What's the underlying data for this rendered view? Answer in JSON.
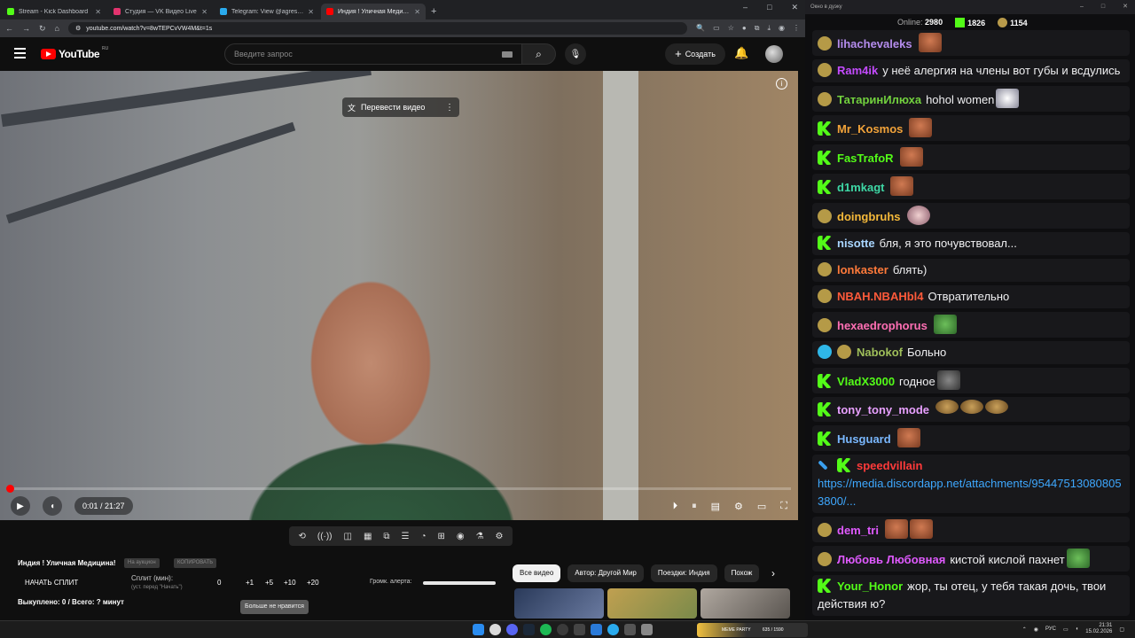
{
  "browser": {
    "tabs": [
      {
        "title": "Stream - Kick Dashboard",
        "color": "#53fc18",
        "active": false
      },
      {
        "title": "Студия — VK Видео Live",
        "color": "#e3336e",
        "active": false
      },
      {
        "title": "Telegram: View @agressorR23",
        "color": "#2aabee",
        "active": false
      },
      {
        "title": "Индия ! Уличная Медицина!",
        "color": "#ff0000",
        "active": true
      }
    ],
    "url": "youtube.com/watch?v=8wTEPCvVW4M&t=1s"
  },
  "youtube": {
    "logo_text": "YouTube",
    "logo_region": "RU",
    "search_placeholder": "Введите запрос",
    "create_label": "Создать"
  },
  "video": {
    "translate_label": "Перевести видео",
    "time": "0:01 / 21:27",
    "progress": 0.0008
  },
  "extension": {
    "title": "Индия ! Уличная Медицина!",
    "auction_btn": "На аукцион",
    "copy_btn": "КОПИРОВАТЬ",
    "start_split": "НАЧАТЬ СПЛИТ",
    "split_label": "Сплит (мин):",
    "split_hint": "(уст. перед \"Начать\")",
    "split_value": "0",
    "increments": [
      "+1",
      "+5",
      "+10",
      "+20"
    ],
    "alert_label": "Громк. алерта:",
    "bought": "Выкуплено: 0 / Всего: ? минут",
    "tooltip": "Больше не нравится"
  },
  "chips": [
    "Все видео",
    "Автор: Другой Мир",
    "Поездки: Индия",
    "Похож"
  ],
  "chat": {
    "window_title": "Окно в дуэку",
    "online_label": "Online:",
    "online": "2980",
    "kick_count": "1826",
    "other_count": "1154",
    "messages": [
      {
        "user": "lihachevaleks",
        "color": "#b48ced",
        "badge": "gold",
        "text": "",
        "emotes": [
          "face"
        ]
      },
      {
        "user": "Ram4ik",
        "color": "#c44bff",
        "badge": "gold",
        "text": "у неё алергия на члены вот губы и всдулись",
        "emotes": []
      },
      {
        "user": "ТатаринИлюха",
        "color": "#72d13e",
        "badge": "gold",
        "text": "hohol women",
        "emotes": [
          "cat"
        ]
      },
      {
        "user": "Mr_Kosmos",
        "color": "#f2a33a",
        "badge": "kick",
        "text": "",
        "emotes": [
          "face"
        ]
      },
      {
        "user": "FasTrafoR",
        "color": "#53fc18",
        "badge": "kick",
        "text": "",
        "emotes": [
          "face"
        ]
      },
      {
        "user": "d1mkagt",
        "color": "#3ed7a5",
        "badge": "kick",
        "text": "",
        "emotes": [
          "face"
        ]
      },
      {
        "user": "doingbruhs",
        "color": "#f5b93a",
        "badge": "gold",
        "text": "",
        "emotes": [
          "mask"
        ]
      },
      {
        "user": "nisotte",
        "color": "#a9d6ff",
        "badge": "kick",
        "text": "бля, я это почувствовал...",
        "emotes": []
      },
      {
        "user": "lonkaster",
        "color": "#ff7a3a",
        "badge": "gold",
        "text": "блять)",
        "emotes": []
      },
      {
        "user": "NBAH.NBAHbl4",
        "color": "#ff5a3a",
        "badge": "gold",
        "text": "Отвратительно",
        "emotes": []
      },
      {
        "user": "hexaedrophorus",
        "color": "#ff6fb4",
        "badge": "gold",
        "text": "",
        "emotes": [
          "frog"
        ]
      },
      {
        "user": "Nabokof",
        "color": "#9fbf5a",
        "badge": "check-gold",
        "text": "Больно",
        "emotes": []
      },
      {
        "user": "VladX3000",
        "color": "#53fc18",
        "badge": "kick",
        "text": "годное",
        "emotes": [
          "knight"
        ]
      },
      {
        "user": "tony_tony_mode",
        "color": "#e8a0ff",
        "badge": "kick",
        "text": "",
        "emotes": [
          "burger",
          "burger",
          "burger"
        ]
      },
      {
        "user": "Husguard",
        "color": "#7ab8ff",
        "badge": "kick",
        "text": "",
        "emotes": [
          "face"
        ]
      },
      {
        "user": "speedvillain",
        "color": "#ff3a3a",
        "badge": "sword-kick",
        "text": "https://media.discordapp.net/attachments/954475130808053800/...",
        "emotes": []
      },
      {
        "user": "dem_tri",
        "color": "#e05aff",
        "badge": "gold",
        "text": "",
        "emotes": [
          "face",
          "face"
        ]
      },
      {
        "user": "Любовь Любовная",
        "color": "#e05aff",
        "badge": "gold",
        "text": "кистой кислой пахнет",
        "emotes": [
          "frog"
        ]
      },
      {
        "user": "Your_Honor",
        "color": "#53fc18",
        "badge": "kick",
        "text": "жор, ты отец, у тебя такая дочь, твои действия ю?",
        "emotes": []
      }
    ]
  },
  "taskbar": {
    "time": "21:31",
    "date": "15.02.2026",
    "lang": "РУС",
    "widget_text": "MEME PARTY",
    "widget_count": "635 / 1590"
  }
}
